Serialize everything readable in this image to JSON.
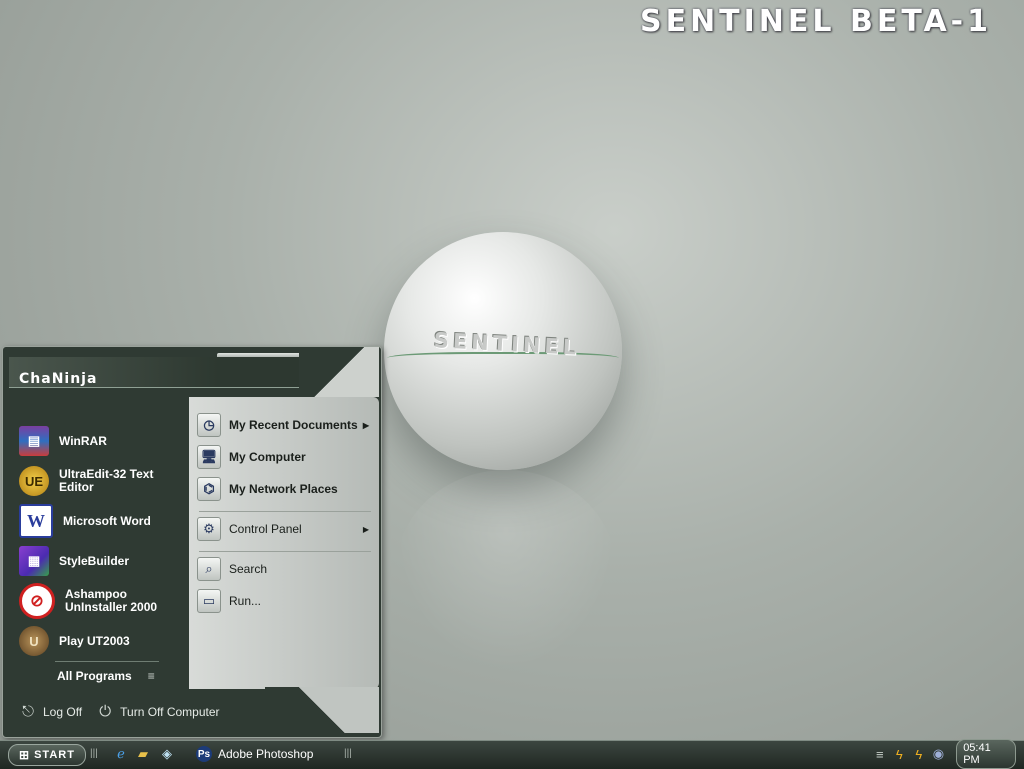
{
  "desktop": {
    "banner": "SENTINEL BETA-1",
    "sphere_label": "SENTINEL"
  },
  "start_menu": {
    "user_name": "ChaNinja",
    "pinned": [
      {
        "label": "WinRAR",
        "icon": "winrar-icon"
      },
      {
        "label": "UltraEdit-32 Text Editor",
        "icon": "ultraedit-icon"
      },
      {
        "label": "Microsoft Word",
        "icon": "word-icon"
      },
      {
        "label": "StyleBuilder",
        "icon": "stylebuilder-icon"
      },
      {
        "label": "Ashampoo UnInstaller 2000",
        "icon": "ashampoo-icon"
      },
      {
        "label": "Play UT2003",
        "icon": "ut2003-icon"
      }
    ],
    "all_programs": "All Programs",
    "log_off": "Log Off",
    "turn_off": "Turn Off Computer",
    "places": [
      {
        "label": "My Recent Documents",
        "submenu": true
      },
      {
        "label": "My Computer",
        "submenu": false
      },
      {
        "label": "My Network Places",
        "submenu": false
      }
    ],
    "system": [
      {
        "label": "Control Panel",
        "submenu": true
      }
    ],
    "tools": [
      {
        "label": "Search"
      },
      {
        "label": "Run..."
      }
    ]
  },
  "taskbar": {
    "start_label": "START",
    "task": "Adobe Photoshop",
    "clock": "05:41 PM"
  },
  "colors": {
    "menu_dark": "#2f3a33",
    "menu_light": "#d8dbd8",
    "accent_green": "#6c9a76"
  }
}
